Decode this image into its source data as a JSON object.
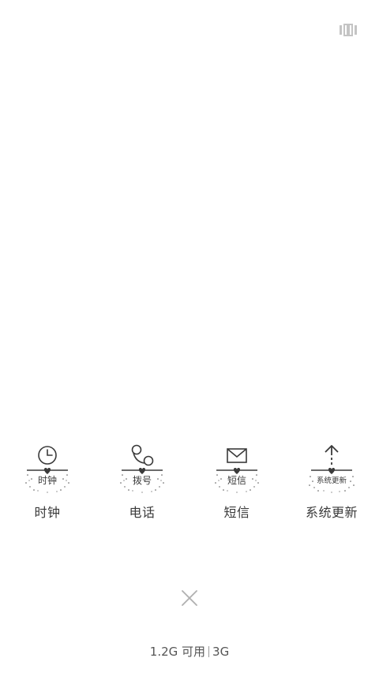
{
  "recents": {
    "apps": [
      {
        "label": "时钟",
        "badge_text": "时钟",
        "icon": "clock-icon"
      },
      {
        "label": "电话",
        "badge_text": "拨号",
        "icon": "phone-icon"
      },
      {
        "label": "短信",
        "badge_text": "短信",
        "icon": "envelope-icon"
      },
      {
        "label": "系统更新",
        "badge_text": "系统更新",
        "icon": "arrow-up-icon"
      }
    ]
  },
  "memory": {
    "available": "1.2G 可用",
    "total": "3G"
  },
  "colors": {
    "background": "#ffffff",
    "icon_stroke": "#3a3a3a",
    "label_text": "#3a3a3a",
    "close_icon": "#b0b0b0"
  }
}
